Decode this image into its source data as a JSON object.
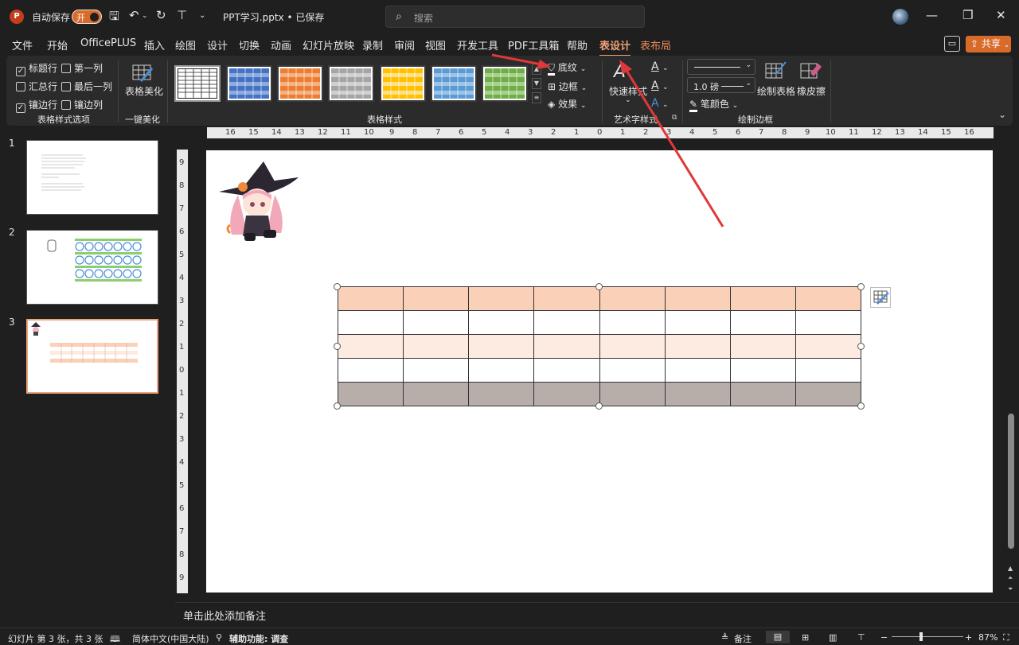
{
  "titlebar": {
    "logo": "P",
    "autosave_label": "自动保存",
    "autosave_state": "开",
    "filename": "PPT学习.pptx • 已保存",
    "search_placeholder": "搜索"
  },
  "menu": {
    "tabs": [
      "文件",
      "开始",
      "OfficePLUS",
      "插入",
      "绘图",
      "设计",
      "切换",
      "动画",
      "幻灯片放映",
      "录制",
      "审阅",
      "视图",
      "开发工具",
      "PDF工具箱",
      "帮助",
      "表设计",
      "表布局"
    ],
    "active_tab": "表设计",
    "share_label": "共享"
  },
  "ribbon": {
    "table_style_options": {
      "header_row": "标题行",
      "first_column": "第一列",
      "total_row": "汇总行",
      "last_column": "最后一列",
      "banded_rows": "镶边行",
      "banded_columns": "镶边列",
      "group_label": "表格样式选项"
    },
    "beautify": {
      "button": "表格美化",
      "group_label": "一键美化"
    },
    "styles": {
      "group_label": "表格样式",
      "shading": "底纹",
      "borders": "边框",
      "effects": "效果"
    },
    "wordart": {
      "quick_styles": "快速样式",
      "group_label": "艺术字样式"
    },
    "draw_borders": {
      "pen_weight": "1.0 磅",
      "pen_color": "笔颜色",
      "draw_table": "绘制表格",
      "eraser": "橡皮擦",
      "group_label": "绘制边框"
    }
  },
  "slides": {
    "numbers": [
      "1",
      "2",
      "3"
    ],
    "selected": "3"
  },
  "ruler": {
    "h_ticks": [
      "16",
      "15",
      "14",
      "13",
      "12",
      "11",
      "10",
      "9",
      "8",
      "7",
      "6",
      "5",
      "4",
      "3",
      "2",
      "1",
      "0",
      "1",
      "2",
      "3",
      "4",
      "5",
      "6",
      "7",
      "8",
      "9",
      "10",
      "11",
      "12",
      "13",
      "14",
      "15",
      "16"
    ],
    "v_ticks": [
      "9",
      "8",
      "7",
      "6",
      "5",
      "4",
      "3",
      "2",
      "1",
      "0",
      "1",
      "2",
      "3",
      "4",
      "5",
      "6",
      "7",
      "8",
      "9"
    ]
  },
  "table": {
    "rows": 5,
    "cols": 8,
    "row_colors": [
      "#fbd0b8",
      "#ffffff",
      "#fdeae0",
      "#ffffff",
      "#b8aea9"
    ]
  },
  "notes_placeholder": "单击此处添加备注",
  "status": {
    "slide_info": "幻灯片 第 3 张，共 3 张",
    "language": "简体中文(中国大陆)",
    "accessibility": "辅助功能: 调查",
    "notes": "备注",
    "zoom": "87%"
  },
  "colors": {
    "accent": "#f2a27a",
    "arrow": "#e0383a",
    "share_button": "#d86a2a"
  }
}
